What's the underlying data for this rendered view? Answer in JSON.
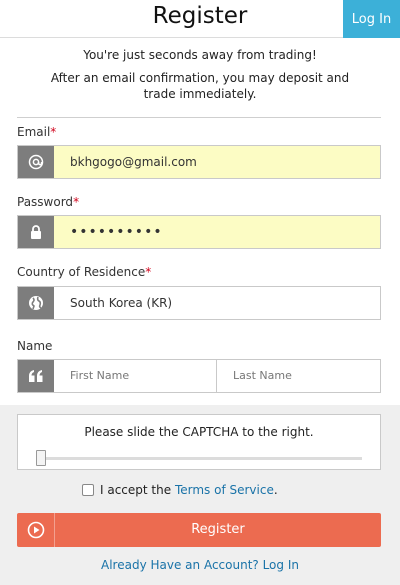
{
  "header": {
    "title": "Register",
    "login_label": "Log In"
  },
  "intro": {
    "line1": "You're just seconds away from trading!",
    "line2": "After an email confirmation, you may deposit and trade immediately."
  },
  "fields": {
    "email": {
      "label": "Email",
      "required": "*",
      "icon": "at-icon",
      "value": "bkhgogo@gmail.com"
    },
    "password": {
      "label": "Password",
      "required": "*",
      "icon": "lock-icon",
      "value": "••••••••••"
    },
    "country": {
      "label": "Country of Residence",
      "required": "*",
      "icon": "globe-icon",
      "value": "South Korea (KR)"
    },
    "name": {
      "label": "Name",
      "icon": "quote-icon",
      "first_placeholder": "First Name",
      "last_placeholder": "Last Name"
    }
  },
  "captcha": {
    "text": "Please slide the CAPTCHA to the right.",
    "progress": 0
  },
  "terms": {
    "prefix": "I accept the",
    "link": "Terms of Service",
    "suffix": "."
  },
  "register_button": {
    "label": "Register",
    "icon": "play-circle-icon"
  },
  "footer": {
    "already_link": "Already Have an Account? Log In"
  },
  "colors": {
    "accent": "#3cb0d8",
    "register": "#ec6b50",
    "autofill": "#fcfcc4",
    "link": "#1a73a8"
  }
}
